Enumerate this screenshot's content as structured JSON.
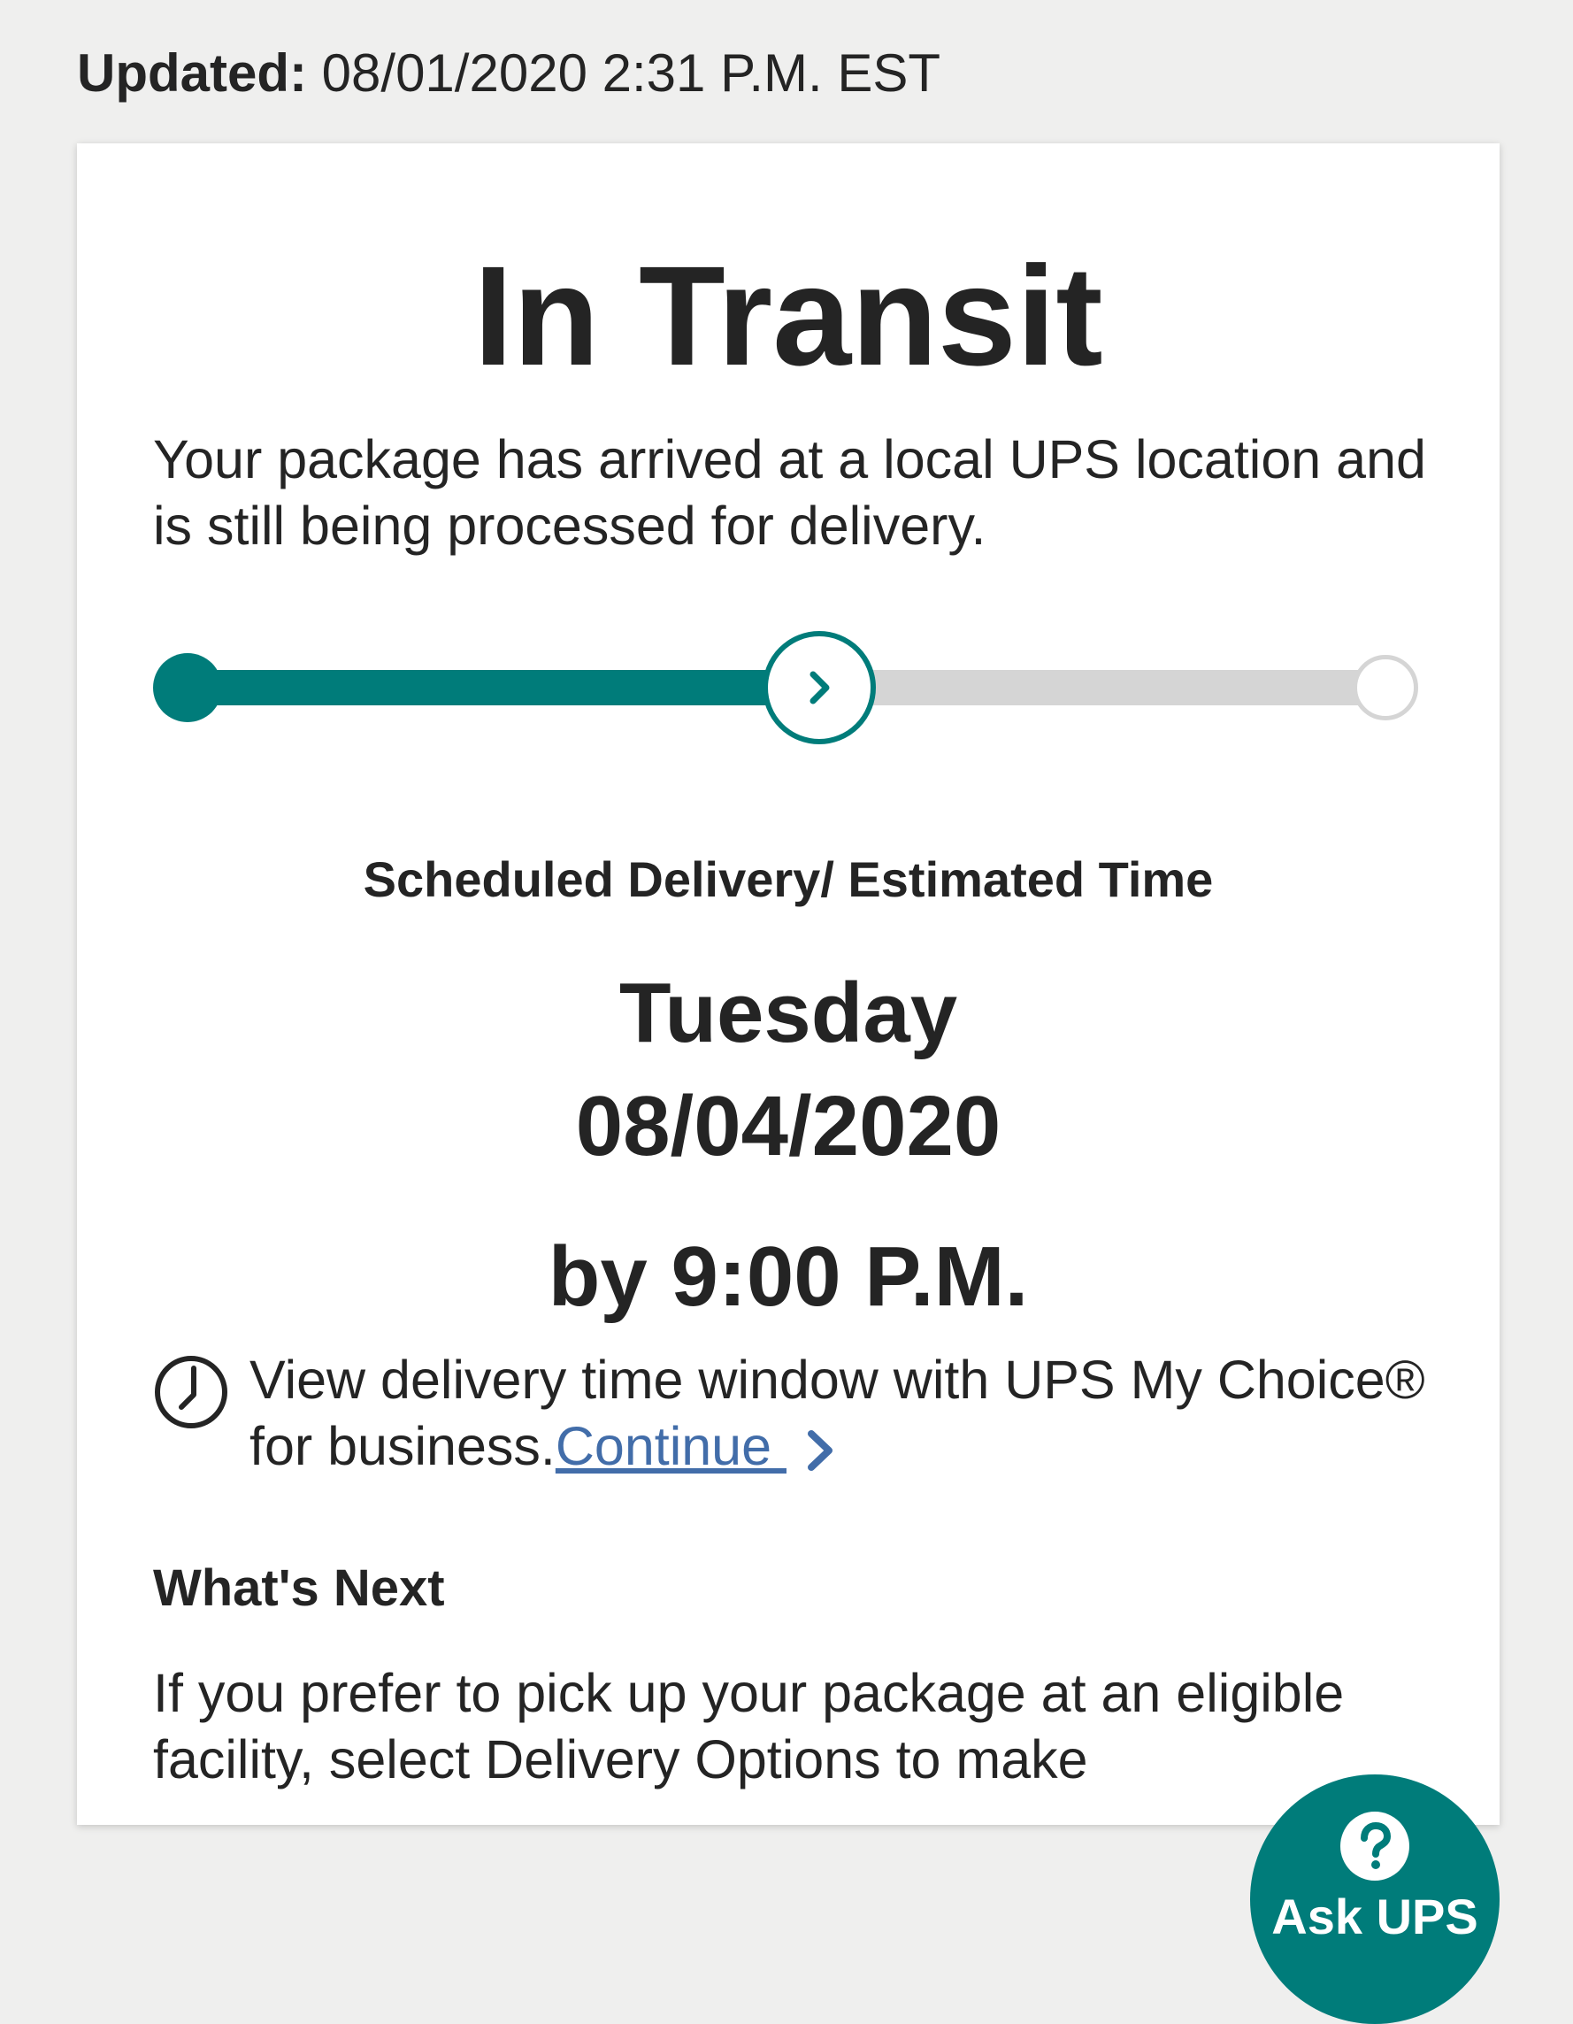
{
  "header": {
    "updated_label": "Updated:",
    "updated_value": "08/01/2020 2:31 P.M. EST"
  },
  "status": {
    "title": "In Transit",
    "description": "Your package has arrived at a local UPS location and is still being processed for delivery."
  },
  "progress": {
    "current_step_fraction": 0.54,
    "current_step_icon": "chevron-right-icon",
    "accent_color": "#007c7a",
    "track_color": "#d5d5d5"
  },
  "delivery": {
    "label": "Scheduled Delivery/ Estimated Time",
    "day": "Tuesday",
    "date": "08/04/2020",
    "time": "by 9:00 P.M."
  },
  "time_window": {
    "icon": "clock-icon",
    "text": "View delivery time window with UPS My Choice® for business.",
    "link_label": "Continue ",
    "link_color": "#426da9"
  },
  "whats_next": {
    "heading": "What's Next",
    "text": "If you prefer to pick up your package at an eligible facility, select Delivery Options to make"
  },
  "ask_ups": {
    "icon": "question-icon",
    "label": "Ask UPS"
  }
}
